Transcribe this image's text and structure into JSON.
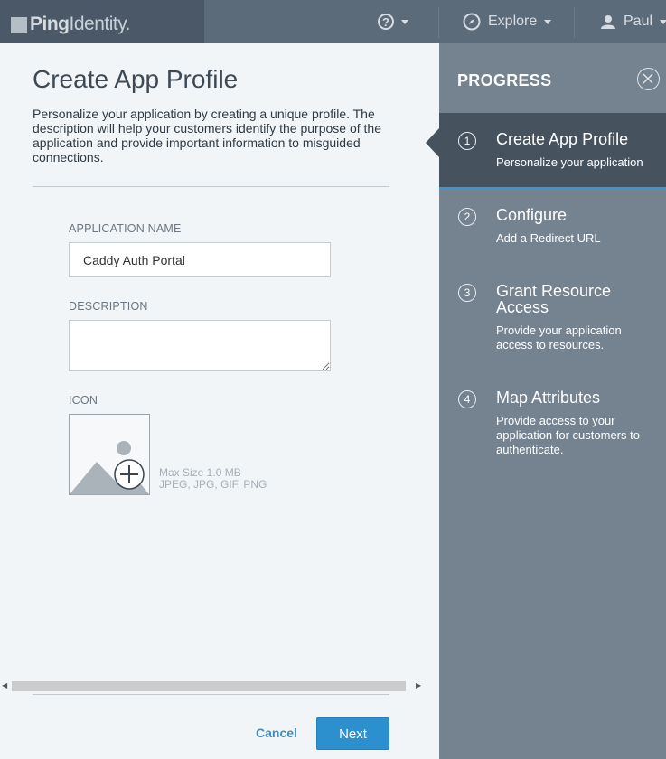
{
  "header": {
    "logo_bold": "Ping",
    "logo_light": "Identity.",
    "help_icon": "?",
    "explore_label": "Explore",
    "user_label": "Paul"
  },
  "form": {
    "title": "Create App Profile",
    "description": "Personalize your application by creating a unique profile. The description will help your customers identify the purpose of the application and provide important information to misguided connections.",
    "app_name_label": "APPLICATION NAME",
    "app_name_value": "Caddy Auth Portal",
    "description_label": "DESCRIPTION",
    "description_value": "",
    "icon_label": "ICON",
    "icon_hint_size": "Max Size 1.0 MB",
    "icon_hint_types": "JPEG, JPG, GIF, PNG",
    "cancel_label": "Cancel",
    "next_label": "Next"
  },
  "progress": {
    "title": "PROGRESS",
    "active_step": 1,
    "steps": [
      {
        "num": "1",
        "title": "Create App Profile",
        "subtitle": "Personalize your application"
      },
      {
        "num": "2",
        "title": "Configure",
        "subtitle": "Add a Redirect URL"
      },
      {
        "num": "3",
        "title": "Grant Resource Access",
        "subtitle": "Provide your application access to resources."
      },
      {
        "num": "4",
        "title": "Map Attributes",
        "subtitle": "Provide access to your application for customers to authenticate."
      }
    ]
  },
  "colors": {
    "topbar": "#5c6b7a",
    "progress_panel": "#758290",
    "active_step": "#46525e",
    "accent": "#2c90cf"
  }
}
